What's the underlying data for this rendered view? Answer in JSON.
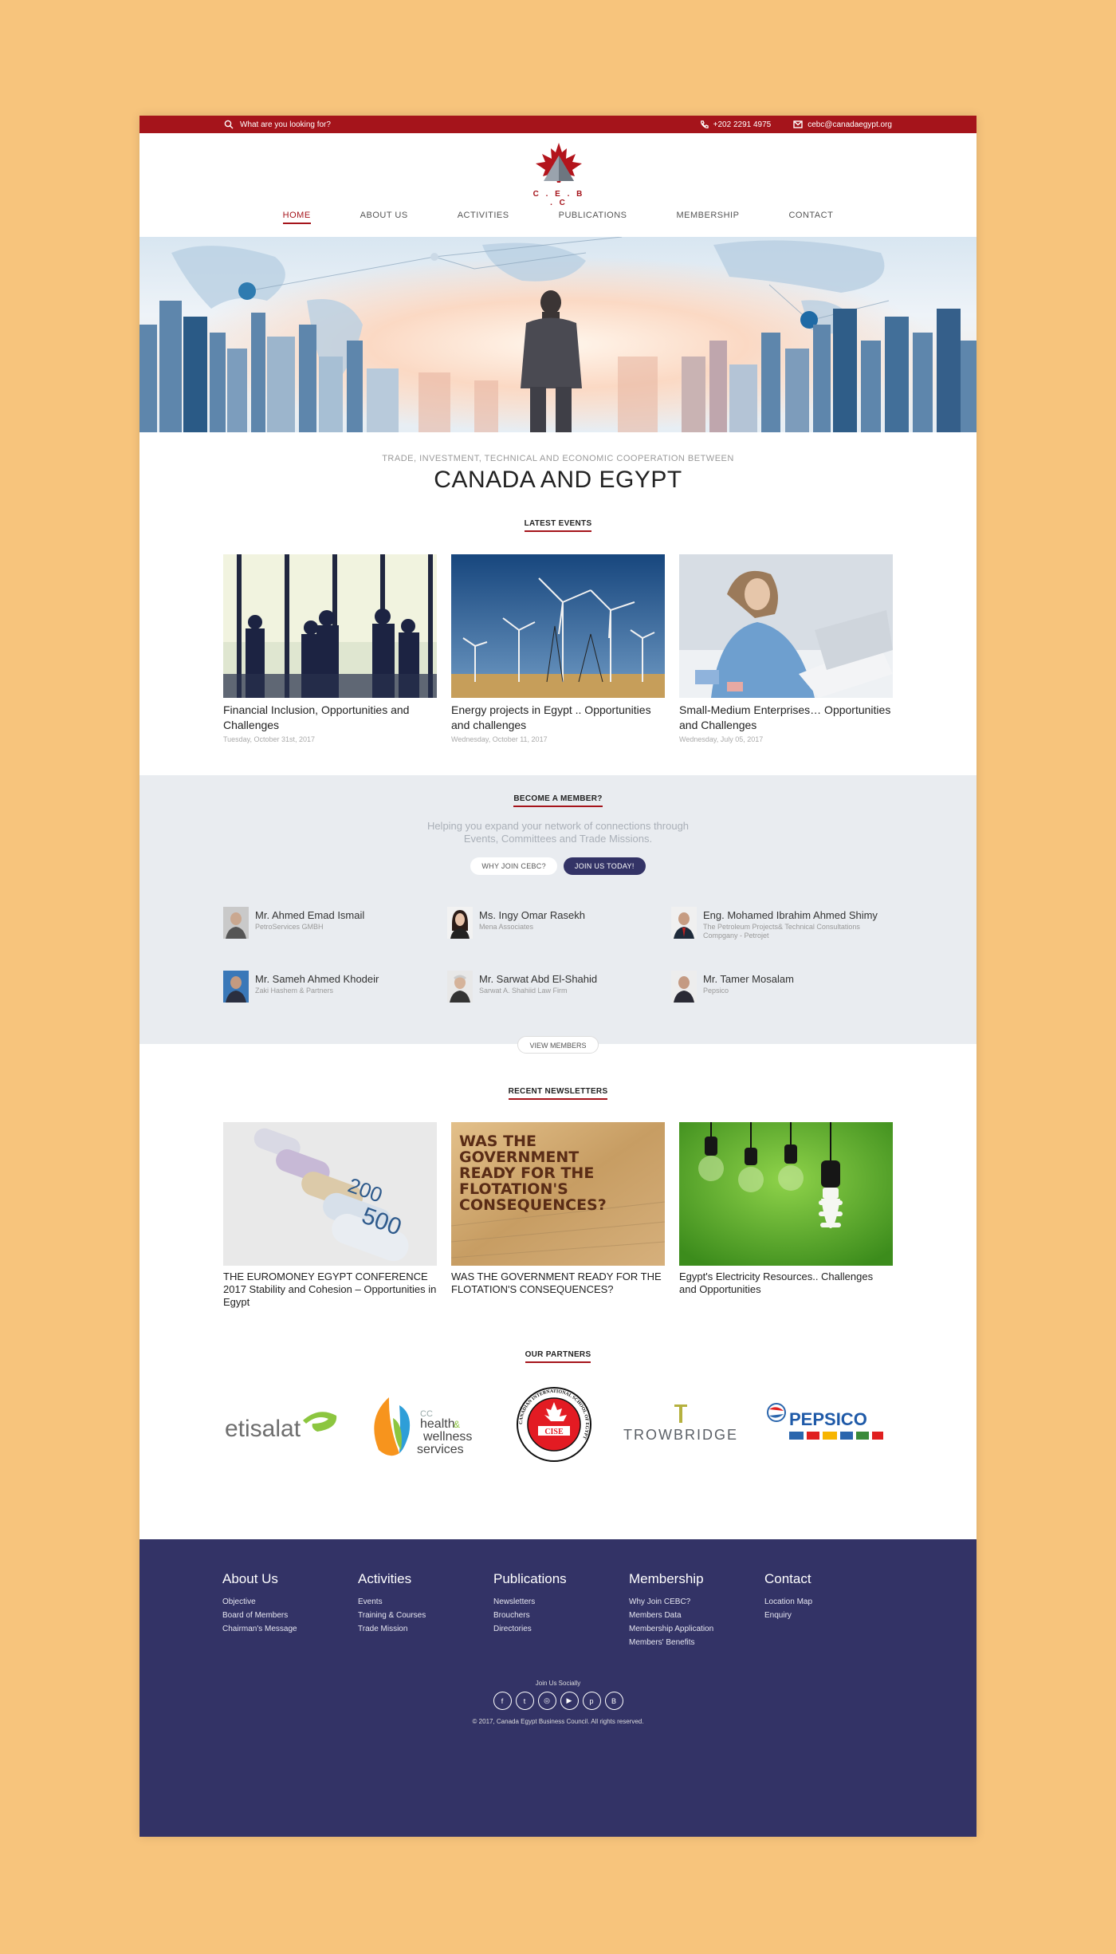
{
  "topbar": {
    "search_placeholder": "What are you looking for?",
    "phone": "+202 2291 4975",
    "email": "cebc@canadaegypt.org"
  },
  "logo": {
    "text": "C . E . B . C"
  },
  "nav": [
    "HOME",
    "ABOUT US",
    "ACTIVITIES",
    "PUBLICATIONS",
    "MEMBERSHIP",
    "CONTACT"
  ],
  "tagline": {
    "small": "TRADE, INVESTMENT, TECHNICAL AND ECONOMIC COOPERATION BETWEEN",
    "big": "CANADA AND EGYPT"
  },
  "events": {
    "title": "LATEST EVENTS",
    "items": [
      {
        "title": "Financial Inclusion, Opportunities and Challenges",
        "date": "Tuesday, October 31st, 2017"
      },
      {
        "title": "Energy projects in Egypt .. Opportunities and challenges",
        "date": "Wednesday, October 11, 2017"
      },
      {
        "title": "Small-Medium Enterprises… Opportunities and Challenges",
        "date": "Wednesday, July 05, 2017"
      }
    ]
  },
  "member": {
    "title": "BECOME A MEMBER?",
    "lead": "Helping you expand your network of connections through Events, Committees and Trade Missions.",
    "why_button": "WHY JOIN CEBC?",
    "join_button": "JOIN US TODAY!",
    "view_button": "VIEW MEMBERS",
    "people": [
      {
        "name": "Mr. Ahmed Emad Ismail",
        "company": "PetroServices GMBH"
      },
      {
        "name": "Ms. Ingy Omar Rasekh",
        "company": "Mena Associates"
      },
      {
        "name": "Eng. Mohamed Ibrahim Ahmed Shimy",
        "company": "The Petroleum Projects& Technical Consultations Compgany - Petrojet"
      },
      {
        "name": "Mr. Sameh Ahmed Khodeir",
        "company": "Zaki Hashem & Partners"
      },
      {
        "name": "Mr. Sarwat Abd El-Shahid",
        "company": "Sarwat A. Shahiid Law Firm"
      },
      {
        "name": "Mr. Tamer Mosalam",
        "company": "Pepsico"
      }
    ]
  },
  "newsletters": {
    "title": "RECENT NEWSLETTERS",
    "items": [
      {
        "title": "THE EUROMONEY EGYPT CONFERENCE 2017 Stability and Cohesion – Opportunities in Egypt"
      },
      {
        "title": "WAS THE GOVERNMENT READY FOR THE FLOTATION'S CONSEQUENCES?",
        "image_text": "WAS THE GOVERNMENT READY FOR THE FLOTATION'S CONSEQUENCES?"
      },
      {
        "title": "Egypt's Electricity Resources.. Challenges and Opportunities"
      }
    ],
    "banknote_values": [
      "200",
      "500"
    ]
  },
  "partners": {
    "title": "OUR PARTNERS",
    "logos": [
      {
        "name": "etisalat",
        "text": "etisalat"
      },
      {
        "name": "health-wellness",
        "text_top": "CC",
        "text_a": "health",
        "text_b": "wellness",
        "text_c": "services",
        "amp": "&"
      },
      {
        "name": "cise",
        "text": "CISE",
        "ring": "CANADIAN INTERNATIONAL SCHOOL OF EGYPT"
      },
      {
        "name": "trowbridge",
        "text": "TROWBRIDGE"
      },
      {
        "name": "pepsico",
        "text": "PEPSICO"
      }
    ]
  },
  "footer": {
    "columns": [
      {
        "title": "About Us",
        "links": [
          "Objective",
          "Board of Members",
          "Chairman's Message"
        ]
      },
      {
        "title": "Activities",
        "links": [
          "Events",
          "Training & Courses",
          "Trade Mission"
        ]
      },
      {
        "title": "Publications",
        "links": [
          "Newsletters",
          "Brouchers",
          "Directories"
        ]
      },
      {
        "title": "Membership",
        "links": [
          "Why Join CEBC?",
          "Members Data",
          "Membership Application",
          "Members' Benefits"
        ]
      },
      {
        "title": "Contact",
        "links": [
          "Location Map",
          "Enquiry"
        ]
      }
    ],
    "social_label": "Join Us Socially",
    "social_icons": [
      {
        "name": "facebook-icon",
        "glyph": "f"
      },
      {
        "name": "twitter-icon",
        "glyph": "t"
      },
      {
        "name": "instagram-icon",
        "glyph": "◎"
      },
      {
        "name": "youtube-icon",
        "glyph": "▶"
      },
      {
        "name": "pinterest-icon",
        "glyph": "p"
      },
      {
        "name": "blogger-icon",
        "glyph": "B"
      }
    ],
    "copyright": "© 2017, Canada Egypt Business Council. All rights reserved."
  },
  "colors": {
    "brand_red": "#a5141b",
    "navy": "#333366",
    "background": "#f7c47c"
  }
}
